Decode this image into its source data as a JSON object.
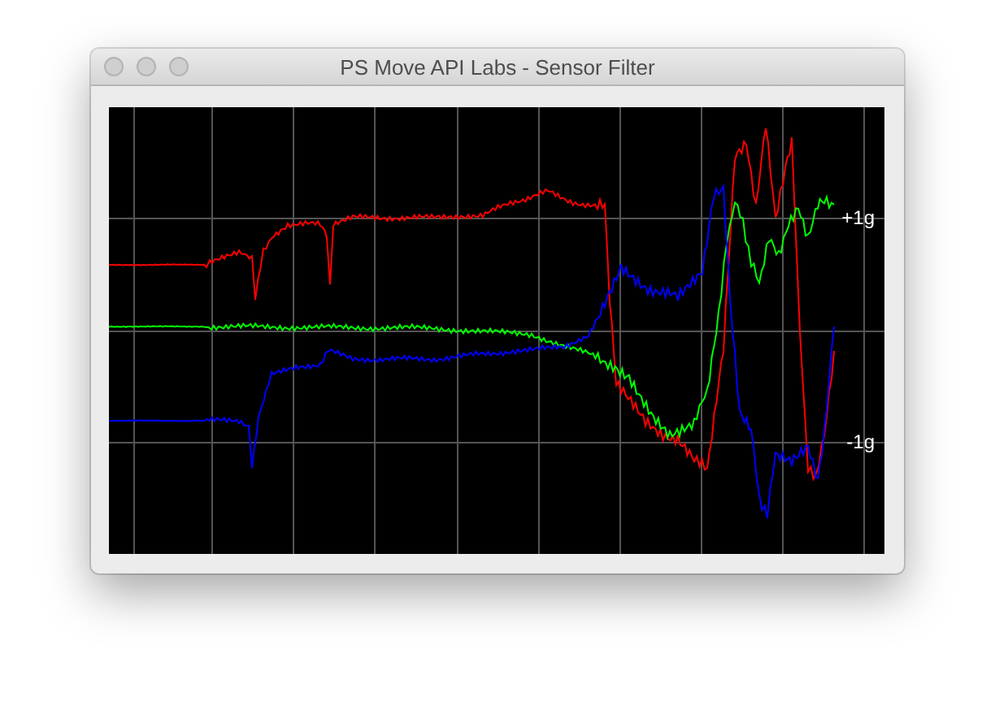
{
  "window": {
    "title": "PS Move API Labs - Sensor Filter"
  },
  "plot": {
    "axis_labels": [
      "+1g",
      "-1g"
    ],
    "traces": [
      {
        "color": "#ff0000"
      },
      {
        "color": "#00ff00"
      },
      {
        "color": "#0000ff"
      }
    ]
  }
}
